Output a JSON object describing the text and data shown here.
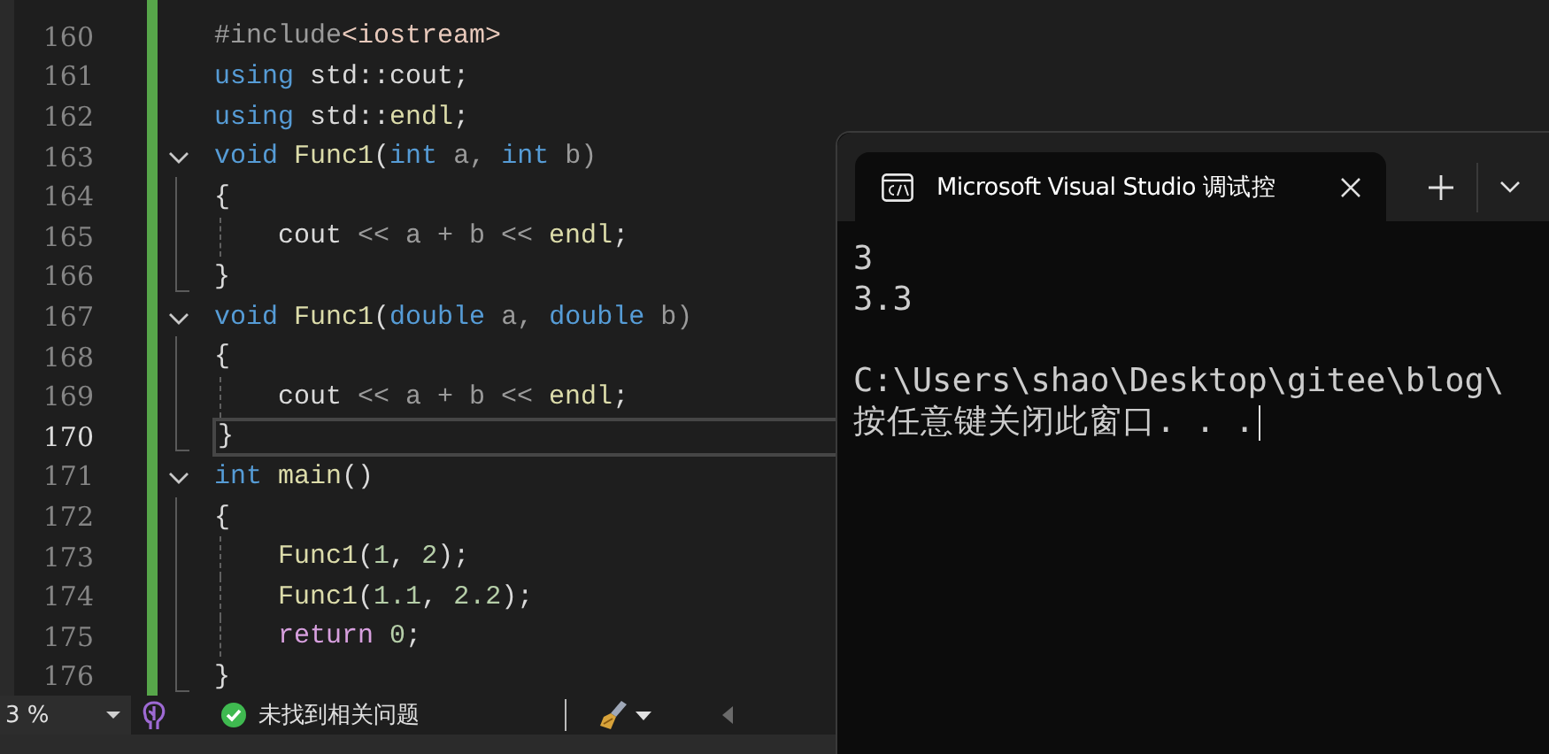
{
  "editor": {
    "lines": [
      {
        "number": "160",
        "kind": "line",
        "selected": false,
        "guide": false,
        "tokens": [
          {
            "text": "#include",
            "kind": "preproc"
          },
          {
            "text": "<iostream>",
            "kind": "header"
          }
        ]
      },
      {
        "number": "161",
        "kind": "line",
        "selected": false,
        "guide": false,
        "tokens": [
          {
            "text": "using",
            "kind": "keyword"
          },
          {
            "text": " std::",
            "kind": "plain"
          },
          {
            "text": "cout",
            "kind": "plain"
          },
          {
            "text": ";",
            "kind": "plain"
          }
        ]
      },
      {
        "number": "162",
        "kind": "line",
        "selected": false,
        "guide": false,
        "tokens": [
          {
            "text": "using",
            "kind": "keyword"
          },
          {
            "text": " std::",
            "kind": "plain"
          },
          {
            "text": "endl",
            "kind": "function"
          },
          {
            "text": ";",
            "kind": "plain"
          }
        ]
      },
      {
        "number": "163",
        "kind": "fold",
        "selected": false,
        "guide": false,
        "tokens": [
          {
            "text": "void",
            "kind": "keyword"
          },
          {
            "text": " Func1",
            "kind": "function"
          },
          {
            "text": "(",
            "kind": "plain"
          },
          {
            "text": "int",
            "kind": "keyword"
          },
          {
            "text": " a, ",
            "kind": "param"
          },
          {
            "text": "int",
            "kind": "keyword"
          },
          {
            "text": " b)",
            "kind": "param"
          }
        ]
      },
      {
        "number": "164",
        "kind": "body",
        "selected": false,
        "guide": false,
        "tokens": [
          {
            "text": "{",
            "kind": "plain"
          }
        ]
      },
      {
        "number": "165",
        "kind": "body",
        "selected": false,
        "guide": true,
        "tokens": [
          {
            "text": "cout",
            "kind": "plain"
          },
          {
            "text": " << a + b << ",
            "kind": "param"
          },
          {
            "text": "endl",
            "kind": "function"
          },
          {
            "text": ";",
            "kind": "plain"
          }
        ]
      },
      {
        "number": "166",
        "kind": "end",
        "selected": false,
        "guide": false,
        "tokens": [
          {
            "text": "}",
            "kind": "plain"
          }
        ]
      },
      {
        "number": "167",
        "kind": "fold",
        "selected": false,
        "guide": false,
        "tokens": [
          {
            "text": "void",
            "kind": "keyword"
          },
          {
            "text": " Func1",
            "kind": "function"
          },
          {
            "text": "(",
            "kind": "plain"
          },
          {
            "text": "double",
            "kind": "keyword"
          },
          {
            "text": " a, ",
            "kind": "param"
          },
          {
            "text": "double",
            "kind": "keyword"
          },
          {
            "text": " b)",
            "kind": "param"
          }
        ]
      },
      {
        "number": "168",
        "kind": "body",
        "selected": false,
        "guide": false,
        "tokens": [
          {
            "text": "{",
            "kind": "plain"
          }
        ]
      },
      {
        "number": "169",
        "kind": "body",
        "selected": false,
        "guide": true,
        "tokens": [
          {
            "text": "cout",
            "kind": "plain"
          },
          {
            "text": " << a + b << ",
            "kind": "param"
          },
          {
            "text": "endl",
            "kind": "function"
          },
          {
            "text": ";",
            "kind": "plain"
          }
        ]
      },
      {
        "number": "170",
        "kind": "end",
        "selected": true,
        "guide": false,
        "tokens": [
          {
            "text": "}",
            "kind": "plain"
          }
        ]
      },
      {
        "number": "171",
        "kind": "fold",
        "selected": false,
        "guide": false,
        "tokens": [
          {
            "text": "int",
            "kind": "keyword"
          },
          {
            "text": " main",
            "kind": "function"
          },
          {
            "text": "()",
            "kind": "plain"
          }
        ]
      },
      {
        "number": "172",
        "kind": "body",
        "selected": false,
        "guide": false,
        "tokens": [
          {
            "text": "{",
            "kind": "plain"
          }
        ]
      },
      {
        "number": "173",
        "kind": "body",
        "selected": false,
        "guide": true,
        "tokens": [
          {
            "text": "Func1",
            "kind": "function"
          },
          {
            "text": "(",
            "kind": "plain"
          },
          {
            "text": "1",
            "kind": "number"
          },
          {
            "text": ", ",
            "kind": "plain"
          },
          {
            "text": "2",
            "kind": "number"
          },
          {
            "text": ");",
            "kind": "plain"
          }
        ]
      },
      {
        "number": "174",
        "kind": "body",
        "selected": false,
        "guide": true,
        "tokens": [
          {
            "text": "Func1",
            "kind": "function"
          },
          {
            "text": "(",
            "kind": "plain"
          },
          {
            "text": "1.1",
            "kind": "number"
          },
          {
            "text": ", ",
            "kind": "plain"
          },
          {
            "text": "2.2",
            "kind": "number"
          },
          {
            "text": ");",
            "kind": "plain"
          }
        ]
      },
      {
        "number": "175",
        "kind": "body",
        "selected": false,
        "guide": true,
        "tokens": [
          {
            "text": "return",
            "kind": "control"
          },
          {
            "text": " 0",
            "kind": "number"
          },
          {
            "text": ";",
            "kind": "plain"
          }
        ]
      },
      {
        "number": "176",
        "kind": "end",
        "selected": false,
        "guide": false,
        "tokens": [
          {
            "text": "}",
            "kind": "plain"
          }
        ]
      }
    ]
  },
  "status_bar": {
    "zoom": "3 %",
    "issues": "未找到相关问题"
  },
  "terminal": {
    "tab": {
      "title": "Microsoft Visual Studio 调试控"
    },
    "output": [
      {
        "kind": "text",
        "text": "3"
      },
      {
        "kind": "text",
        "text": "3.3"
      },
      {
        "kind": "blank"
      },
      {
        "kind": "text",
        "text": "C:\\Users\\shao\\Desktop\\gitee\\blog\\"
      },
      {
        "kind": "text",
        "text": "按任意键关闭此窗口. . ."
      }
    ]
  }
}
